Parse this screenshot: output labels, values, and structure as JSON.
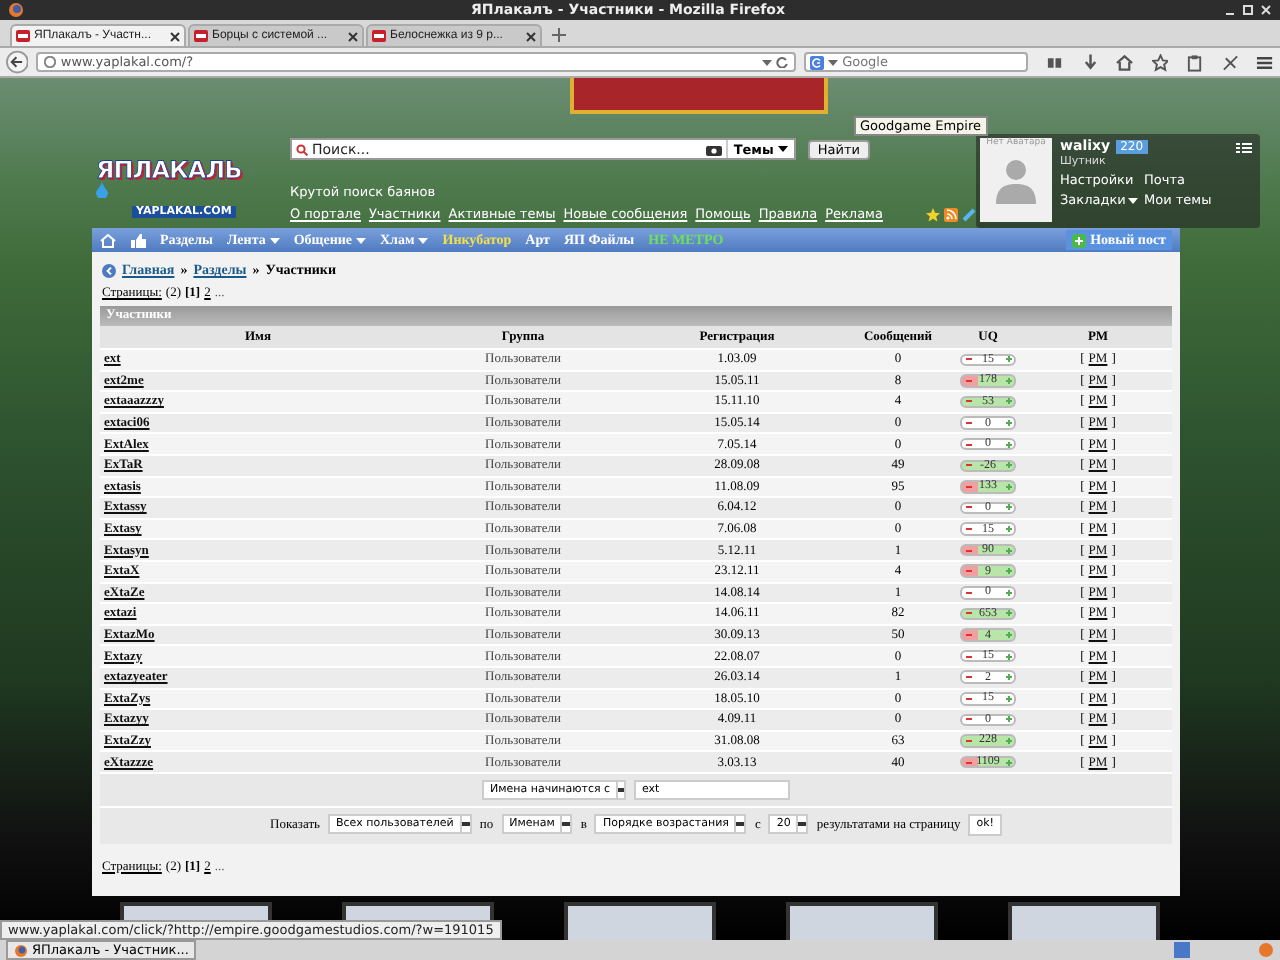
{
  "window": {
    "title": "ЯПлакалъ - Участники - Mozilla Firefox"
  },
  "tabs": [
    {
      "label": "ЯПлакалъ - Участн...",
      "selected": true
    },
    {
      "label": "Борцы с системой ...",
      "selected": false
    },
    {
      "label": "Белоснежка из 9 р...",
      "selected": false
    }
  ],
  "address_bar": {
    "url": "www.yaplakal.com/?"
  },
  "browser_search": {
    "placeholder": "Google"
  },
  "tooltip": "Goodgame Empire",
  "site_header": {
    "logo": "ЯПЛАКАЛЬ",
    "logo_domain": "YAPLAKAL.COM",
    "search": {
      "placeholder": "Поиск...",
      "scope": "Темы",
      "button": "Найти",
      "hint": "Крутой поиск баянов"
    },
    "links": [
      "О портале",
      "Участники",
      "Активные темы",
      "Новые сообщения",
      "Помощь",
      "Правила",
      "Реклама"
    ]
  },
  "user_panel": {
    "avatar_caption": "Нет Аватара",
    "username": "walixy",
    "points": "220",
    "rank": "Шутник",
    "links": [
      {
        "label": "Настройки",
        "dropdown": false
      },
      {
        "label": "Почта",
        "dropdown": false
      },
      {
        "label": "Закладки",
        "dropdown": true
      },
      {
        "label": "Мои темы",
        "dropdown": false
      }
    ]
  },
  "nav": [
    {
      "label": "Разделы",
      "dropdown": false,
      "color": "#ffffff"
    },
    {
      "label": "Лента",
      "dropdown": true,
      "color": "#ffffff"
    },
    {
      "label": "Общение",
      "dropdown": true,
      "color": "#ffffff"
    },
    {
      "label": "Хлам",
      "dropdown": true,
      "color": "#ffffff"
    },
    {
      "label": "Инкубатор",
      "dropdown": false,
      "color": "#f2e04a"
    },
    {
      "label": "Арт",
      "dropdown": false,
      "color": "#ffffff"
    },
    {
      "label": "ЯП Файлы",
      "dropdown": false,
      "color": "#ffffff"
    },
    {
      "label": "НЕ МЕТРО",
      "dropdown": false,
      "color": "#6ee05a"
    }
  ],
  "new_post_button": "Новый пост",
  "breadcrumb": {
    "separator": "»",
    "items": [
      {
        "label": "Главная",
        "link": true
      },
      {
        "label": "Разделы",
        "link": true
      },
      {
        "label": "Участники",
        "link": false
      }
    ]
  },
  "pagination_top": {
    "label": "Страницы:",
    "count": "(2)",
    "current": "[1]",
    "pages": [
      "2"
    ],
    "more": "..."
  },
  "members_table": {
    "title": "Участники",
    "columns": [
      "Имя",
      "Группа",
      "Регистрация",
      "Сообщений",
      "UQ",
      "PM"
    ],
    "pm_open": "[",
    "pm_close": "]",
    "rows": [
      {
        "name": "ext",
        "group": "Пользователи",
        "registered": "1.03.09",
        "posts": "0",
        "uq": "15",
        "uq_positive": false,
        "uq_negative": false,
        "pm": "PM"
      },
      {
        "name": "ext2me",
        "group": "Пользователи",
        "registered": "15.05.11",
        "posts": "8",
        "uq": "178",
        "uq_positive": true,
        "uq_negative": true,
        "pm": "PM"
      },
      {
        "name": "extaaazzzy",
        "group": "Пользователи",
        "registered": "15.11.10",
        "posts": "4",
        "uq": "53",
        "uq_positive": true,
        "uq_negative": false,
        "pm": "PM"
      },
      {
        "name": "extaci06",
        "group": "Пользователи",
        "registered": "15.05.14",
        "posts": "0",
        "uq": "0",
        "uq_positive": false,
        "uq_negative": false,
        "pm": "PM"
      },
      {
        "name": "ExtAlex",
        "group": "Пользователи",
        "registered": "7.05.14",
        "posts": "0",
        "uq": "0",
        "uq_positive": false,
        "uq_negative": false,
        "pm": "PM"
      },
      {
        "name": "ExTaR",
        "group": "Пользователи",
        "registered": "28.09.08",
        "posts": "49",
        "uq": "-26",
        "uq_positive": true,
        "uq_negative": false,
        "pm": "PM"
      },
      {
        "name": "extasis",
        "group": "Пользователи",
        "registered": "11.08.09",
        "posts": "95",
        "uq": "133",
        "uq_positive": true,
        "uq_negative": true,
        "pm": "PM"
      },
      {
        "name": "Extassy",
        "group": "Пользователи",
        "registered": "6.04.12",
        "posts": "0",
        "uq": "0",
        "uq_positive": false,
        "uq_negative": false,
        "pm": "PM"
      },
      {
        "name": "Extasy",
        "group": "Пользователи",
        "registered": "7.06.08",
        "posts": "0",
        "uq": "15",
        "uq_positive": false,
        "uq_negative": false,
        "pm": "PM"
      },
      {
        "name": "Extasyn",
        "group": "Пользователи",
        "registered": "5.12.11",
        "posts": "1",
        "uq": "90",
        "uq_positive": true,
        "uq_negative": true,
        "pm": "PM"
      },
      {
        "name": "ExtaX",
        "group": "Пользователи",
        "registered": "23.12.11",
        "posts": "4",
        "uq": "9",
        "uq_positive": true,
        "uq_negative": true,
        "pm": "PM"
      },
      {
        "name": "eXtaZe",
        "group": "Пользователи",
        "registered": "14.08.14",
        "posts": "1",
        "uq": "0",
        "uq_positive": false,
        "uq_negative": false,
        "pm": "PM"
      },
      {
        "name": "extazi",
        "group": "Пользователи",
        "registered": "14.06.11",
        "posts": "82",
        "uq": "653",
        "uq_positive": true,
        "uq_negative": false,
        "pm": "PM"
      },
      {
        "name": "ExtazMo",
        "group": "Пользователи",
        "registered": "30.09.13",
        "posts": "50",
        "uq": "4",
        "uq_positive": true,
        "uq_negative": true,
        "pm": "PM"
      },
      {
        "name": "Extazy",
        "group": "Пользователи",
        "registered": "22.08.07",
        "posts": "0",
        "uq": "15",
        "uq_positive": false,
        "uq_negative": false,
        "pm": "PM"
      },
      {
        "name": "extazyeater",
        "group": "Пользователи",
        "registered": "26.03.14",
        "posts": "1",
        "uq": "2",
        "uq_positive": false,
        "uq_negative": false,
        "pm": "PM"
      },
      {
        "name": "ExtaZys",
        "group": "Пользователи",
        "registered": "18.05.10",
        "posts": "0",
        "uq": "15",
        "uq_positive": false,
        "uq_negative": false,
        "pm": "PM"
      },
      {
        "name": "Extazyy",
        "group": "Пользователи",
        "registered": "4.09.11",
        "posts": "0",
        "uq": "0",
        "uq_positive": false,
        "uq_negative": false,
        "pm": "PM"
      },
      {
        "name": "ExtaZzy",
        "group": "Пользователи",
        "registered": "31.08.08",
        "posts": "63",
        "uq": "228",
        "uq_positive": true,
        "uq_negative": false,
        "pm": "PM"
      },
      {
        "name": "eXtazzze",
        "group": "Пользователи",
        "registered": "3.03.13",
        "posts": "40",
        "uq": "1109",
        "uq_positive": true,
        "uq_negative": true,
        "pm": "PM"
      }
    ]
  },
  "name_filter": {
    "mode": "Имена начинаются с",
    "value": "ext"
  },
  "sort_controls": [
    {
      "kind": "text",
      "text": "Показать"
    },
    {
      "kind": "select",
      "text": "Всех пользователей"
    },
    {
      "kind": "text",
      "text": "по"
    },
    {
      "kind": "select",
      "text": "Именам"
    },
    {
      "kind": "text",
      "text": "в"
    },
    {
      "kind": "select",
      "text": "Порядке возрастания"
    },
    {
      "kind": "text",
      "text": "с"
    },
    {
      "kind": "select",
      "text": "20"
    },
    {
      "kind": "text",
      "text": "результатами на страницу"
    },
    {
      "kind": "button",
      "text": "ok!"
    }
  ],
  "pagination_bottom": {
    "label": "Страницы:",
    "count": "(2)",
    "current": "[1]",
    "pages": [
      "2"
    ],
    "more": "..."
  },
  "status_link": "www.yaplakal.com/click/?http://empire.goodgamestudios.com/?w=191015",
  "taskbar": {
    "task": "ЯПлакалъ - Участник..."
  }
}
